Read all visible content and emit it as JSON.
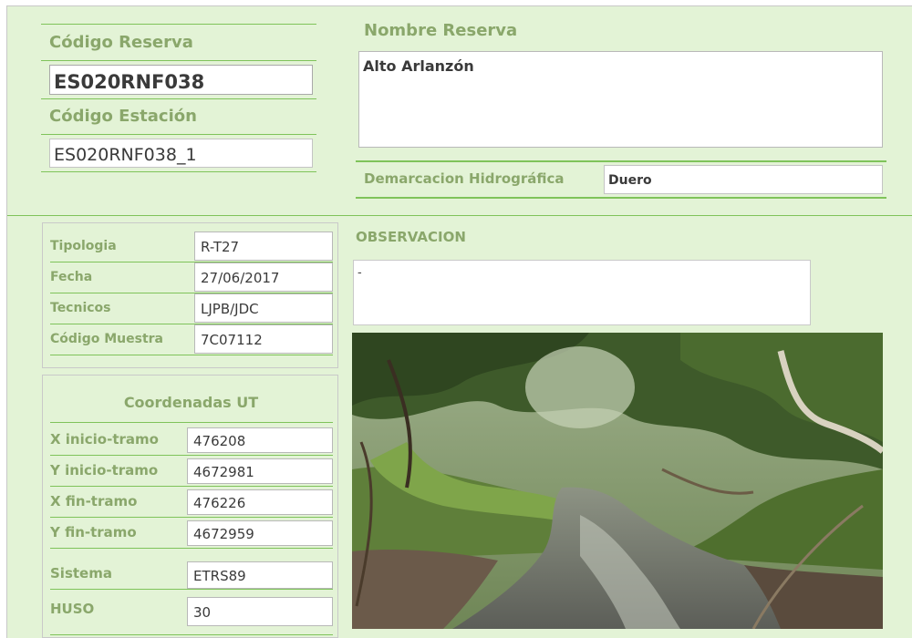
{
  "header": {
    "codigo_reserva_label": "Código Reserva",
    "codigo_reserva_value": "ES020RNF038",
    "codigo_estacion_label": "Código Estación",
    "codigo_estacion_value": "ES020RNF038_1",
    "nombre_reserva_label": "Nombre Reserva",
    "nombre_reserva_value": "Alto Arlanzón",
    "demarcacion_label": "Demarcacion Hidrográfica",
    "demarcacion_value": "Duero"
  },
  "info": {
    "rows": [
      {
        "key": "Tipologia",
        "value": "R-T27"
      },
      {
        "key": "Fecha",
        "value": "27/06/2017"
      },
      {
        "key": "Tecnicos",
        "value": "LJPB/JDC"
      },
      {
        "key": "Código Muestra",
        "value": "7C07112"
      }
    ]
  },
  "coords": {
    "title": "Coordenadas UT",
    "rows": [
      {
        "key": "X inicio-tramo",
        "value": "476208"
      },
      {
        "key": "Y inicio-tramo",
        "value": "4672981"
      },
      {
        "key": "X fin-tramo",
        "value": "476226"
      },
      {
        "key": "Y fin-tramo",
        "value": "4672959"
      },
      {
        "key": "Sistema",
        "value": "ETRS89"
      },
      {
        "key": "HUSO",
        "value": "30"
      }
    ]
  },
  "observacion": {
    "label": "OBSERVACION",
    "value": "-"
  },
  "colors": {
    "background": "#e3f3d6",
    "label": "#8aa76b",
    "rule": "#7fc35a"
  },
  "photo": {
    "subject": "forest-stream-photo"
  }
}
